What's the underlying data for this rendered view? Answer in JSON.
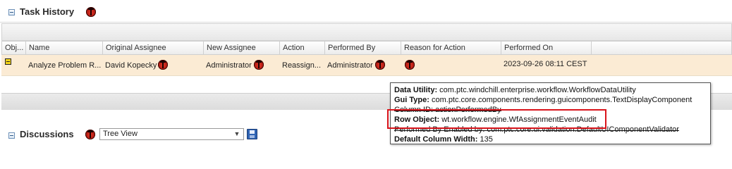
{
  "task_history": {
    "title": "Task History"
  },
  "grid": {
    "columns": [
      "Obj...",
      "Name",
      "Original Assignee",
      "New Assignee",
      "Action",
      "Performed By",
      "Reason for Action",
      "Performed On"
    ],
    "row": {
      "name": "Analyze Problem R...",
      "original_assignee": "David Kopecky",
      "new_assignee": "Administrator",
      "action": "Reassign...",
      "performed_by": "Administrator",
      "performed_on": "2023-09-26 08:11 CEST"
    }
  },
  "tooltip": {
    "lines": [
      {
        "label": "Data Utility:",
        "value": " com.ptc.windchill.enterprise.workflow.WorkflowDataUtility"
      },
      {
        "label": "Gui Type:",
        "value": " com.ptc.core.components.rendering.guicomponents.TextDisplayComponent"
      },
      {
        "label": "Column ID:",
        "value": " actionPerformedBy"
      },
      {
        "label": "Row Object:",
        "value": " wt.workflow.engine.WfAssignmentEventAudit"
      },
      {
        "label": "Performed By Enabled by:",
        "value": " com.ptc.core.ui.validation.DefaultUIComponentValidator"
      },
      {
        "label": "Default Column Width:",
        "value": " 135"
      }
    ]
  },
  "discussions": {
    "title": "Discussions",
    "view_select_value": "Tree View"
  },
  "icons": {
    "collapse": "collapse-minus-icon",
    "bug": "ladybug-debug-icon",
    "object_type": "object-type-icon",
    "save": "save-disk-icon",
    "dropdown": "chevron-down-icon"
  }
}
